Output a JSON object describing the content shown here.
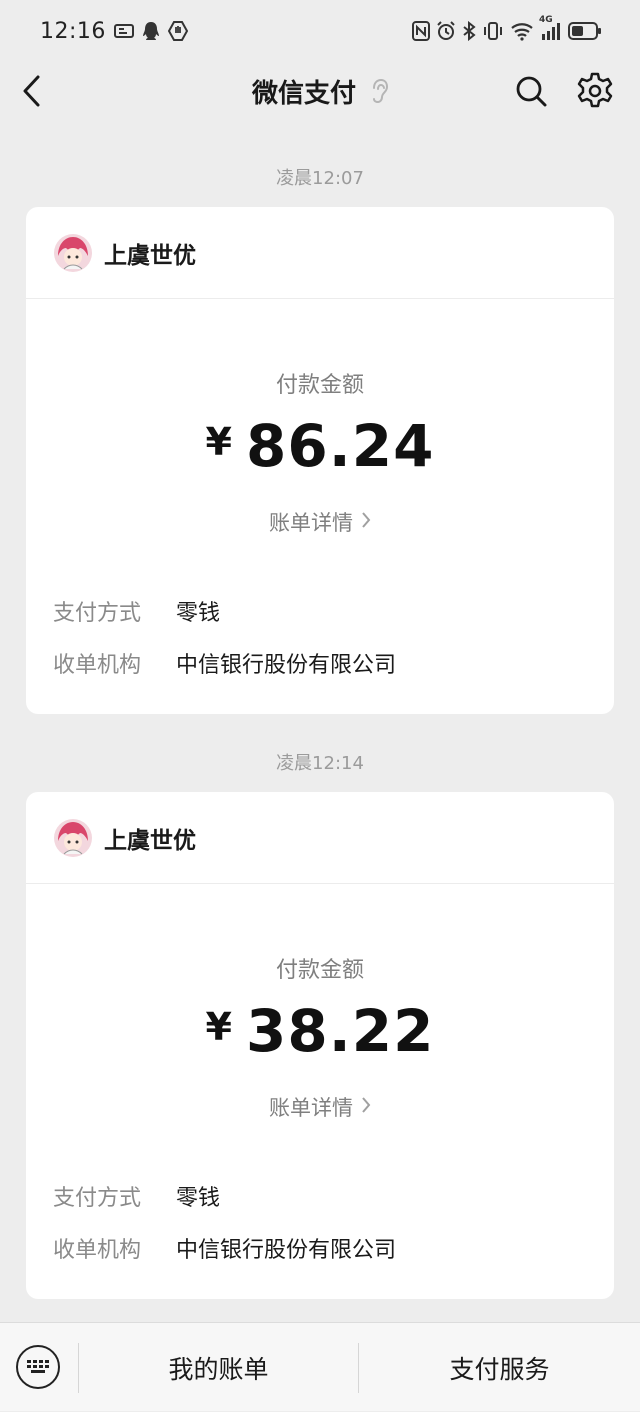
{
  "status_bar": {
    "time": "12:16",
    "network": "4G"
  },
  "nav": {
    "title": "微信支付"
  },
  "transactions": [
    {
      "timestamp": "凌晨12:07",
      "merchant": "上虞世优",
      "amount_label": "付款金额",
      "currency": "¥",
      "amount": "86.24",
      "detail_link": "账单详情",
      "payment_method_label": "支付方式",
      "payment_method": "零钱",
      "institution_label": "收单机构",
      "institution": "中信银行股份有限公司"
    },
    {
      "timestamp": "凌晨12:14",
      "merchant": "上虞世优",
      "amount_label": "付款金额",
      "currency": "¥",
      "amount": "38.22",
      "detail_link": "账单详情",
      "payment_method_label": "支付方式",
      "payment_method": "零钱",
      "institution_label": "收单机构",
      "institution": "中信银行股份有限公司"
    }
  ],
  "bottom_bar": {
    "my_bills": "我的账单",
    "pay_services": "支付服务"
  },
  "colors": {
    "background": "#ededed",
    "card": "#ffffff",
    "muted_text": "#7f7f7f"
  }
}
